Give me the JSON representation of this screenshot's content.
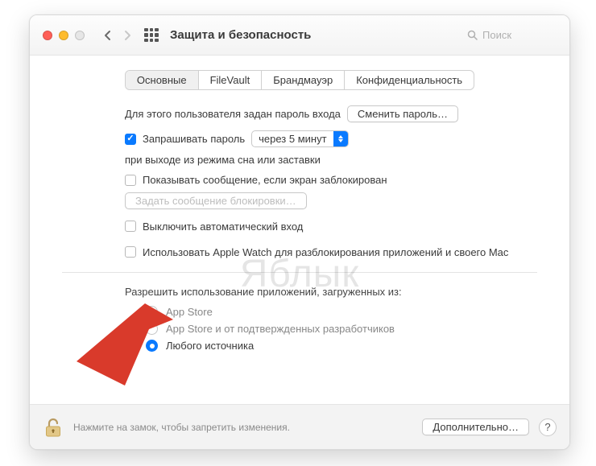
{
  "header": {
    "title": "Защита и безопасность",
    "search_placeholder": "Поиск"
  },
  "tabs": {
    "t0": "Основные",
    "t1": "FileVault",
    "t2": "Брандмауэр",
    "t3": "Конфиденциальность"
  },
  "pwd": {
    "intro": "Для этого пользователя задан пароль входа",
    "change": "Сменить пароль…",
    "require": "Запрашивать пароль",
    "delay": "через 5 минут",
    "after": "при выходе из режима сна или заставки",
    "show_msg": "Показывать сообщение, если экран заблокирован",
    "set_msg": "Задать сообщение блокировки…",
    "disable_auto": "Выключить автоматический вход",
    "apple_watch": "Использовать Apple Watch для разблокирования приложений и своего Mac"
  },
  "allow": {
    "title": "Разрешить использование приложений, загруженных из:",
    "o0": "App Store",
    "o1": "App Store и от подтвержденных разработчиков",
    "o2": "Любого источника"
  },
  "bottom": {
    "hint": "Нажмите на замок, чтобы запретить изменения.",
    "advanced": "Дополнительно…"
  },
  "watermark": "Яблык"
}
